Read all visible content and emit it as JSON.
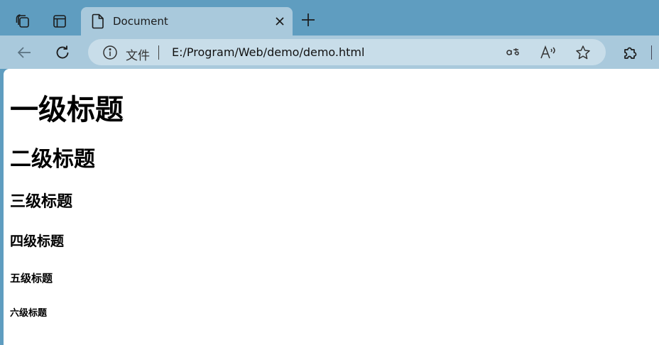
{
  "tab": {
    "title": "Document"
  },
  "address_bar": {
    "scheme_label": "文件",
    "url": "E:/Program/Web/demo/demo.html"
  },
  "page": {
    "headings": [
      "一级标题",
      "二级标题",
      "三级标题",
      "四级标题",
      "五级标题",
      "六级标题"
    ]
  },
  "icons": {
    "workspaces": "workspaces-icon",
    "tab_actions": "tab-actions-icon",
    "tab_favicon": "document-icon",
    "close": "close-icon",
    "new_tab": "plus-icon",
    "back": "back-arrow-icon",
    "refresh": "refresh-icon",
    "site_info": "info-icon",
    "translate": "translate-icon",
    "read_aloud": "read-aloud-icon",
    "favorite": "star-icon",
    "extensions": "puzzle-icon"
  },
  "colors": {
    "tab_strip": "#5f9dc0",
    "toolbar": "#a9c9dc",
    "address_field": "#c8dde9",
    "page_background": "#ffffff"
  }
}
